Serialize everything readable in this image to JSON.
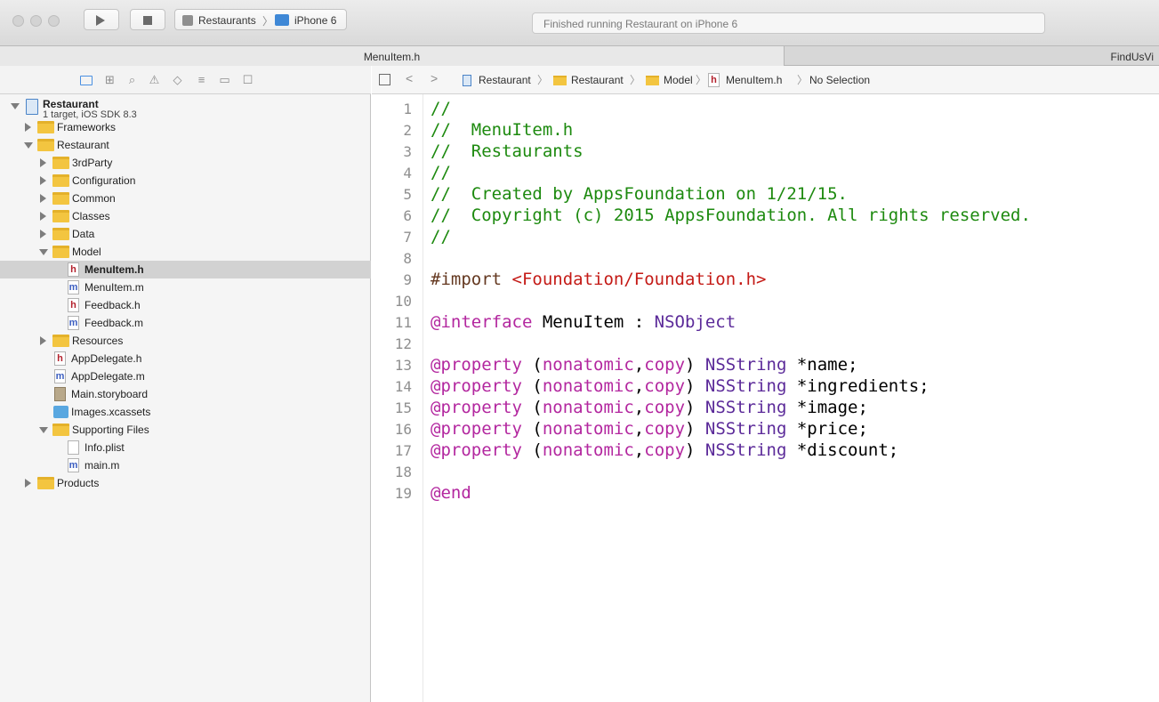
{
  "toolbar": {
    "scheme_target": "Restaurants",
    "scheme_separator": "〉",
    "scheme_device": "iPhone 6",
    "activity_status": "Finished running Restaurant on iPhone 6"
  },
  "tabs": [
    {
      "label": "MenuItem.h"
    },
    {
      "label": "FindUsVi"
    }
  ],
  "navigator": {
    "project": {
      "name": "Restaurant",
      "subtitle": "1 target, iOS SDK 8.3"
    },
    "items": [
      {
        "label": "Frameworks"
      },
      {
        "label": "Restaurant"
      },
      {
        "label": "3rdParty"
      },
      {
        "label": "Configuration"
      },
      {
        "label": "Common"
      },
      {
        "label": "Classes"
      },
      {
        "label": "Data"
      },
      {
        "label": "Model"
      },
      {
        "label": "MenuItem.h"
      },
      {
        "label": "MenuItem.m"
      },
      {
        "label": "Feedback.h"
      },
      {
        "label": "Feedback.m"
      },
      {
        "label": "Resources"
      },
      {
        "label": "AppDelegate.h"
      },
      {
        "label": "AppDelegate.m"
      },
      {
        "label": "Main.storyboard"
      },
      {
        "label": "Images.xcassets"
      },
      {
        "label": "Supporting Files"
      },
      {
        "label": "Info.plist"
      },
      {
        "label": "main.m"
      },
      {
        "label": "Products"
      }
    ],
    "file_badges": {
      "h": "h",
      "m": "m"
    }
  },
  "jumpbar": {
    "sep": "〉",
    "crumbs": [
      "Restaurant",
      "Restaurant",
      "Model",
      "MenuItem.h",
      "No Selection"
    ]
  },
  "editor": {
    "line_numbers": [
      "1",
      "2",
      "3",
      "4",
      "5",
      "6",
      "7",
      "8",
      "9",
      "10",
      "11",
      "12",
      "13",
      "14",
      "15",
      "16",
      "17",
      "18",
      "19"
    ],
    "lines": {
      "l1": "//",
      "l2": "//  MenuItem.h",
      "l3": "//  Restaurants",
      "l4": "//",
      "l5": "//  Created by AppsFoundation on 1/21/15.",
      "l6": "//  Copyright (c) 2015 AppsFoundation. All rights reserved.",
      "l7": "//",
      "l9_directive": "#import ",
      "l9_path": "<Foundation/Foundation.h>",
      "l11_kw": "@interface",
      "l11_name": " MenuItem : ",
      "l11_super": "NSObject",
      "prop_kw": "@property",
      "prop_attrs_open": " (",
      "prop_attr1": "nonatomic",
      "prop_comma": ",",
      "prop_attr2": "copy",
      "prop_attrs_close": ") ",
      "prop_type": "NSString",
      "props": [
        " *name;",
        " *ingredients;",
        " *image;",
        " *price;",
        " *discount;"
      ],
      "l19": "@end"
    }
  }
}
